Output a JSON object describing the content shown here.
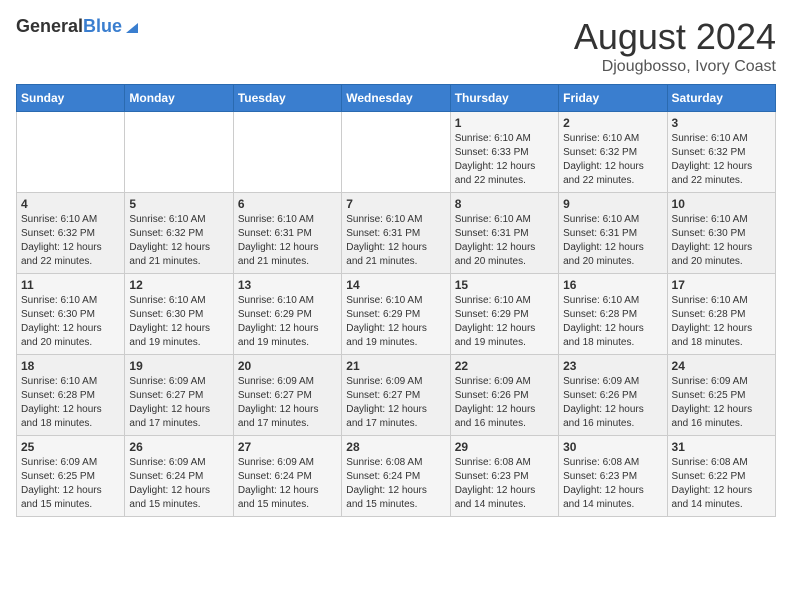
{
  "header": {
    "logo_general": "General",
    "logo_blue": "Blue",
    "title": "August 2024",
    "subtitle": "Djougbosso, Ivory Coast"
  },
  "days_of_week": [
    "Sunday",
    "Monday",
    "Tuesday",
    "Wednesday",
    "Thursday",
    "Friday",
    "Saturday"
  ],
  "weeks": [
    {
      "days": [
        {
          "num": "",
          "info": ""
        },
        {
          "num": "",
          "info": ""
        },
        {
          "num": "",
          "info": ""
        },
        {
          "num": "",
          "info": ""
        },
        {
          "num": "1",
          "info": "Sunrise: 6:10 AM\nSunset: 6:33 PM\nDaylight: 12 hours\nand 22 minutes."
        },
        {
          "num": "2",
          "info": "Sunrise: 6:10 AM\nSunset: 6:32 PM\nDaylight: 12 hours\nand 22 minutes."
        },
        {
          "num": "3",
          "info": "Sunrise: 6:10 AM\nSunset: 6:32 PM\nDaylight: 12 hours\nand 22 minutes."
        }
      ]
    },
    {
      "days": [
        {
          "num": "4",
          "info": "Sunrise: 6:10 AM\nSunset: 6:32 PM\nDaylight: 12 hours\nand 22 minutes."
        },
        {
          "num": "5",
          "info": "Sunrise: 6:10 AM\nSunset: 6:32 PM\nDaylight: 12 hours\nand 21 minutes."
        },
        {
          "num": "6",
          "info": "Sunrise: 6:10 AM\nSunset: 6:31 PM\nDaylight: 12 hours\nand 21 minutes."
        },
        {
          "num": "7",
          "info": "Sunrise: 6:10 AM\nSunset: 6:31 PM\nDaylight: 12 hours\nand 21 minutes."
        },
        {
          "num": "8",
          "info": "Sunrise: 6:10 AM\nSunset: 6:31 PM\nDaylight: 12 hours\nand 20 minutes."
        },
        {
          "num": "9",
          "info": "Sunrise: 6:10 AM\nSunset: 6:31 PM\nDaylight: 12 hours\nand 20 minutes."
        },
        {
          "num": "10",
          "info": "Sunrise: 6:10 AM\nSunset: 6:30 PM\nDaylight: 12 hours\nand 20 minutes."
        }
      ]
    },
    {
      "days": [
        {
          "num": "11",
          "info": "Sunrise: 6:10 AM\nSunset: 6:30 PM\nDaylight: 12 hours\nand 20 minutes."
        },
        {
          "num": "12",
          "info": "Sunrise: 6:10 AM\nSunset: 6:30 PM\nDaylight: 12 hours\nand 19 minutes."
        },
        {
          "num": "13",
          "info": "Sunrise: 6:10 AM\nSunset: 6:29 PM\nDaylight: 12 hours\nand 19 minutes."
        },
        {
          "num": "14",
          "info": "Sunrise: 6:10 AM\nSunset: 6:29 PM\nDaylight: 12 hours\nand 19 minutes."
        },
        {
          "num": "15",
          "info": "Sunrise: 6:10 AM\nSunset: 6:29 PM\nDaylight: 12 hours\nand 19 minutes."
        },
        {
          "num": "16",
          "info": "Sunrise: 6:10 AM\nSunset: 6:28 PM\nDaylight: 12 hours\nand 18 minutes."
        },
        {
          "num": "17",
          "info": "Sunrise: 6:10 AM\nSunset: 6:28 PM\nDaylight: 12 hours\nand 18 minutes."
        }
      ]
    },
    {
      "days": [
        {
          "num": "18",
          "info": "Sunrise: 6:10 AM\nSunset: 6:28 PM\nDaylight: 12 hours\nand 18 minutes."
        },
        {
          "num": "19",
          "info": "Sunrise: 6:09 AM\nSunset: 6:27 PM\nDaylight: 12 hours\nand 17 minutes."
        },
        {
          "num": "20",
          "info": "Sunrise: 6:09 AM\nSunset: 6:27 PM\nDaylight: 12 hours\nand 17 minutes."
        },
        {
          "num": "21",
          "info": "Sunrise: 6:09 AM\nSunset: 6:27 PM\nDaylight: 12 hours\nand 17 minutes."
        },
        {
          "num": "22",
          "info": "Sunrise: 6:09 AM\nSunset: 6:26 PM\nDaylight: 12 hours\nand 16 minutes."
        },
        {
          "num": "23",
          "info": "Sunrise: 6:09 AM\nSunset: 6:26 PM\nDaylight: 12 hours\nand 16 minutes."
        },
        {
          "num": "24",
          "info": "Sunrise: 6:09 AM\nSunset: 6:25 PM\nDaylight: 12 hours\nand 16 minutes."
        }
      ]
    },
    {
      "days": [
        {
          "num": "25",
          "info": "Sunrise: 6:09 AM\nSunset: 6:25 PM\nDaylight: 12 hours\nand 15 minutes."
        },
        {
          "num": "26",
          "info": "Sunrise: 6:09 AM\nSunset: 6:24 PM\nDaylight: 12 hours\nand 15 minutes."
        },
        {
          "num": "27",
          "info": "Sunrise: 6:09 AM\nSunset: 6:24 PM\nDaylight: 12 hours\nand 15 minutes."
        },
        {
          "num": "28",
          "info": "Sunrise: 6:08 AM\nSunset: 6:24 PM\nDaylight: 12 hours\nand 15 minutes."
        },
        {
          "num": "29",
          "info": "Sunrise: 6:08 AM\nSunset: 6:23 PM\nDaylight: 12 hours\nand 14 minutes."
        },
        {
          "num": "30",
          "info": "Sunrise: 6:08 AM\nSunset: 6:23 PM\nDaylight: 12 hours\nand 14 minutes."
        },
        {
          "num": "31",
          "info": "Sunrise: 6:08 AM\nSunset: 6:22 PM\nDaylight: 12 hours\nand 14 minutes."
        }
      ]
    }
  ]
}
